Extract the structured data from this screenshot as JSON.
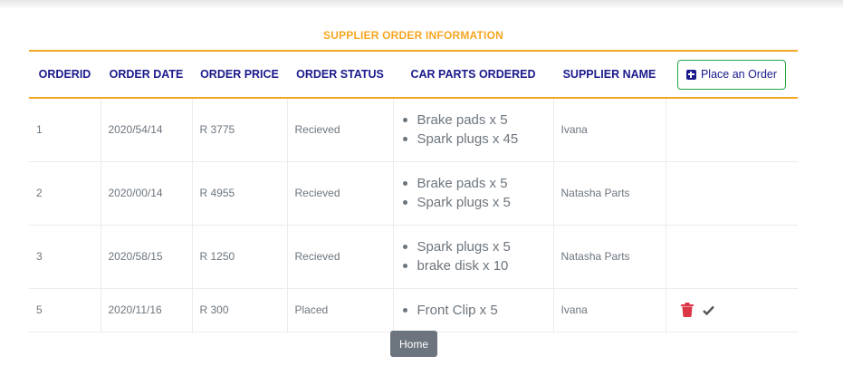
{
  "page": {
    "title": "SUPPLIER ORDER INFORMATION"
  },
  "table": {
    "headers": [
      "ORDERID",
      "ORDER DATE",
      "ORDER PRICE",
      "ORDER STATUS",
      "CAR PARTS ORDERED",
      "SUPPLIER NAME"
    ],
    "place_order_label": "Place an Order",
    "rows": [
      {
        "order_id": "1",
        "date": "2020/54/14",
        "price": "R 3775",
        "status": "Recieved",
        "parts": [
          "Brake pads x 5",
          "Spark plugs x 45"
        ],
        "supplier": "Ivana"
      },
      {
        "order_id": "2",
        "date": "2020/00/14",
        "price": "R 4955",
        "status": "Recieved",
        "parts": [
          "Brake pads x 5",
          "Spark plugs x 5"
        ],
        "supplier": "Natasha Parts"
      },
      {
        "order_id": "3",
        "date": "2020/58/15",
        "price": "R 1250",
        "status": "Recieved",
        "parts": [
          "Spark plugs x 5",
          "brake disk x 10"
        ],
        "supplier": "Natasha Parts"
      },
      {
        "order_id": "5",
        "date": "2020/11/16",
        "price": "R 300",
        "status": "Placed",
        "parts": [
          "Front Clip x 5"
        ],
        "supplier": "Ivana"
      }
    ]
  },
  "actions": {
    "delete_icon": "trash-icon",
    "confirm_icon": "check-icon"
  },
  "footer": {
    "home_label": "Home"
  },
  "colors": {
    "accent": "#f5a623",
    "header_text": "#1a1a8c",
    "button_border": "#28a745",
    "delete": "#dc3545",
    "home_button": "#6c757d"
  }
}
